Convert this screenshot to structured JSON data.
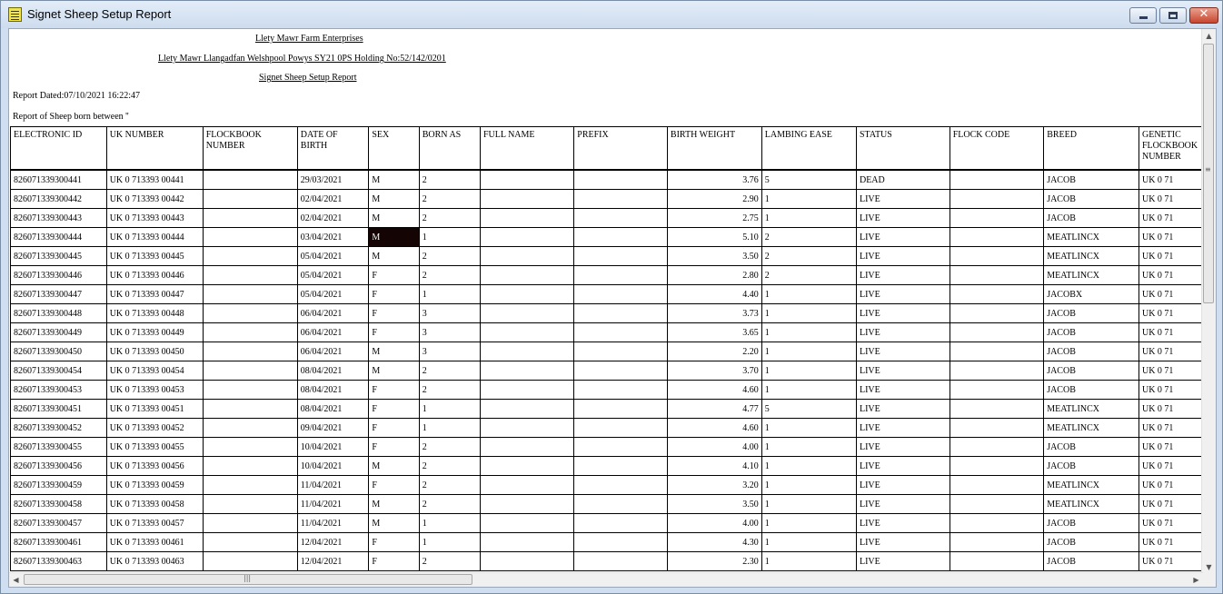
{
  "window": {
    "title": "Signet Sheep Setup Report",
    "close_glyph": "✕"
  },
  "report": {
    "company": "Llety Mawr Farm Enterprises",
    "address": "Llety Mawr Llangadfan Welshpool Powys SY21 0PS Holding No:52/142/0201",
    "heading": "Signet Sheep Setup Report",
    "dated": "Report Dated:07/10/2021 16:22:47",
    "range": "Report of Sheep born between ''"
  },
  "table": {
    "columns": [
      "ELECTRONIC ID",
      "UK NUMBER",
      "FLOCKBOOK NUMBER",
      "DATE OF BIRTH",
      "SEX",
      "BORN AS",
      "FULL NAME",
      "PREFIX",
      "BIRTH WEIGHT",
      "LAMBING EASE",
      "STATUS",
      "FLOCK CODE",
      "BREED",
      "GENETIC FLOCKBOOK NUMBER"
    ],
    "rows": [
      [
        "826071339300441",
        "UK 0 713393 00441",
        "",
        "29/03/2021",
        "M",
        "2",
        "",
        "",
        "3.76",
        "5",
        "DEAD",
        "",
        "JACOB",
        "UK 0 71"
      ],
      [
        "826071339300442",
        "UK 0 713393 00442",
        "",
        "02/04/2021",
        "M",
        "2",
        "",
        "",
        "2.90",
        "1",
        "LIVE",
        "",
        "JACOB",
        "UK 0 71"
      ],
      [
        "826071339300443",
        "UK 0 713393 00443",
        "",
        "02/04/2021",
        "M",
        "2",
        "",
        "",
        "2.75",
        "1",
        "LIVE",
        "",
        "JACOB",
        "UK 0 71"
      ],
      [
        "826071339300444",
        "UK 0 713393 00444",
        "",
        "03/04/2021",
        "M",
        "1",
        "",
        "",
        "5.10",
        "2",
        "LIVE",
        "",
        "MEATLINCX",
        "UK 0 71"
      ],
      [
        "826071339300445",
        "UK 0 713393 00445",
        "",
        "05/04/2021",
        "M",
        "2",
        "",
        "",
        "3.50",
        "2",
        "LIVE",
        "",
        "MEATLINCX",
        "UK 0 71"
      ],
      [
        "826071339300446",
        "UK 0 713393 00446",
        "",
        "05/04/2021",
        "F",
        "2",
        "",
        "",
        "2.80",
        "2",
        "LIVE",
        "",
        "MEATLINCX",
        "UK 0 71"
      ],
      [
        "826071339300447",
        "UK 0 713393 00447",
        "",
        "05/04/2021",
        "F",
        "1",
        "",
        "",
        "4.40",
        "1",
        "LIVE",
        "",
        "JACOBX",
        "UK 0 71"
      ],
      [
        "826071339300448",
        "UK 0 713393 00448",
        "",
        "06/04/2021",
        "F",
        "3",
        "",
        "",
        "3.73",
        "1",
        "LIVE",
        "",
        "JACOB",
        "UK 0 71"
      ],
      [
        "826071339300449",
        "UK 0 713393 00449",
        "",
        "06/04/2021",
        "F",
        "3",
        "",
        "",
        "3.65",
        "1",
        "LIVE",
        "",
        "JACOB",
        "UK 0 71"
      ],
      [
        "826071339300450",
        "UK 0 713393 00450",
        "",
        "06/04/2021",
        "M",
        "3",
        "",
        "",
        "2.20",
        "1",
        "LIVE",
        "",
        "JACOB",
        "UK 0 71"
      ],
      [
        "826071339300454",
        "UK 0 713393 00454",
        "",
        "08/04/2021",
        "M",
        "2",
        "",
        "",
        "3.70",
        "1",
        "LIVE",
        "",
        "JACOB",
        "UK 0 71"
      ],
      [
        "826071339300453",
        "UK 0 713393 00453",
        "",
        "08/04/2021",
        "F",
        "2",
        "",
        "",
        "4.60",
        "1",
        "LIVE",
        "",
        "JACOB",
        "UK 0 71"
      ],
      [
        "826071339300451",
        "UK 0 713393 00451",
        "",
        "08/04/2021",
        "F",
        "1",
        "",
        "",
        "4.77",
        "5",
        "LIVE",
        "",
        "MEATLINCX",
        "UK 0 71"
      ],
      [
        "826071339300452",
        "UK 0 713393 00452",
        "",
        "09/04/2021",
        "F",
        "1",
        "",
        "",
        "4.60",
        "1",
        "LIVE",
        "",
        "MEATLINCX",
        "UK 0 71"
      ],
      [
        "826071339300455",
        "UK 0 713393 00455",
        "",
        "10/04/2021",
        "F",
        "2",
        "",
        "",
        "4.00",
        "1",
        "LIVE",
        "",
        "JACOB",
        "UK 0 71"
      ],
      [
        "826071339300456",
        "UK 0 713393 00456",
        "",
        "10/04/2021",
        "M",
        "2",
        "",
        "",
        "4.10",
        "1",
        "LIVE",
        "",
        "JACOB",
        "UK 0 71"
      ],
      [
        "826071339300459",
        "UK 0 713393 00459",
        "",
        "11/04/2021",
        "F",
        "2",
        "",
        "",
        "3.20",
        "1",
        "LIVE",
        "",
        "MEATLINCX",
        "UK 0 71"
      ],
      [
        "826071339300458",
        "UK 0 713393 00458",
        "",
        "11/04/2021",
        "M",
        "2",
        "",
        "",
        "3.50",
        "1",
        "LIVE",
        "",
        "MEATLINCX",
        "UK 0 71"
      ],
      [
        "826071339300457",
        "UK 0 713393 00457",
        "",
        "11/04/2021",
        "M",
        "1",
        "",
        "",
        "4.00",
        "1",
        "LIVE",
        "",
        "JACOB",
        "UK 0 71"
      ],
      [
        "826071339300461",
        "UK 0 713393 00461",
        "",
        "12/04/2021",
        "F",
        "1",
        "",
        "",
        "4.30",
        "1",
        "LIVE",
        "",
        "JACOB",
        "UK 0 71"
      ],
      [
        "826071339300463",
        "UK 0 713393 00463",
        "",
        "12/04/2021",
        "F",
        "2",
        "",
        "",
        "2.30",
        "1",
        "LIVE",
        "",
        "JACOB",
        "UK 0 71"
      ]
    ],
    "selected_cell": {
      "row": 3,
      "col": 4
    }
  },
  "colors": {
    "selection": "#140404",
    "close_button": "#c7462f"
  }
}
